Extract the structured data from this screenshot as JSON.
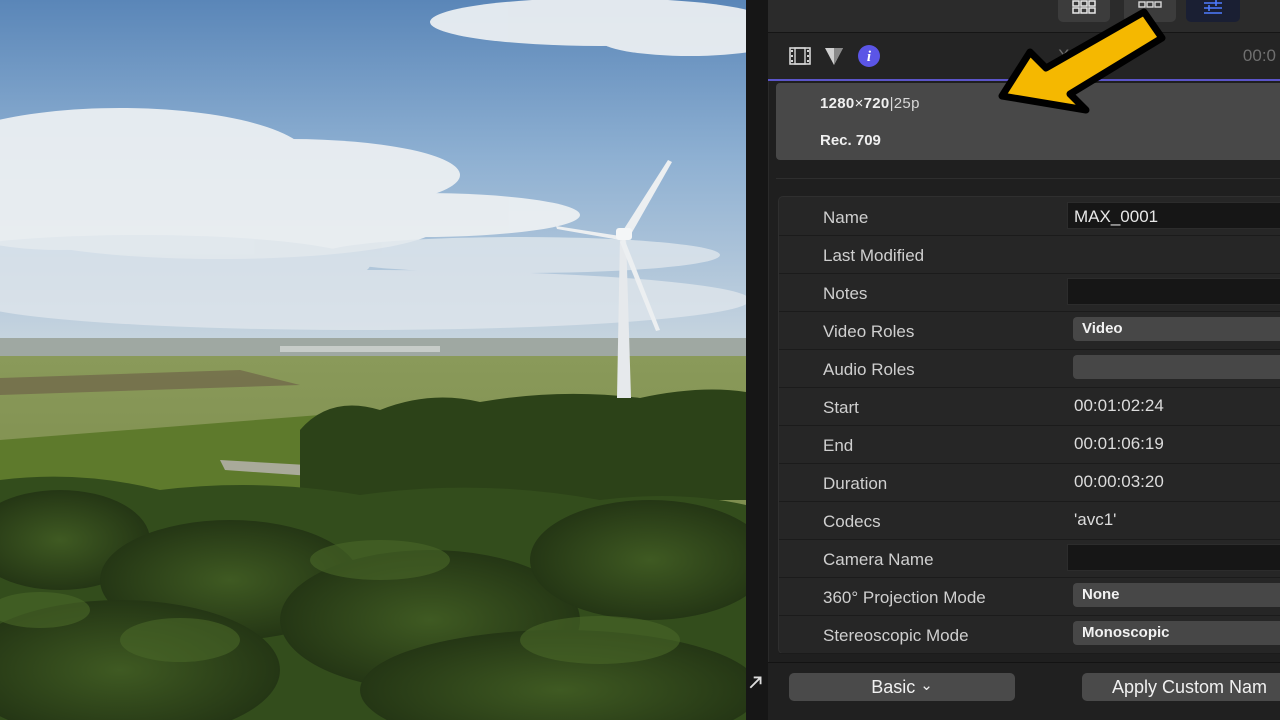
{
  "viewer": {},
  "inspector": {
    "toolbar": {
      "icons": [
        "grid-view-icon",
        "filmstrip-view-icon",
        "inspector-sliders-icon"
      ]
    },
    "tabs": {
      "icons": [
        "film-icon",
        "audio-triangle-icon",
        "info-icon"
      ],
      "clip_name": "X",
      "timecode": "00:0"
    },
    "summary": {
      "width": "1280",
      "times": "×",
      "height": "720",
      "separator": "|",
      "frame_rate": "25p",
      "color_space": "Rec. 709"
    },
    "properties": [
      {
        "label": "Name",
        "kind": "field",
        "value": "MAX_0001"
      },
      {
        "label": "Last Modified",
        "kind": "text",
        "value": ""
      },
      {
        "label": "Notes",
        "kind": "field",
        "value": ""
      },
      {
        "label": "Video Roles",
        "kind": "popup",
        "value": "Video"
      },
      {
        "label": "Audio Roles",
        "kind": "popup",
        "value": ""
      },
      {
        "label": "Start",
        "kind": "text",
        "value": "00:01:02:24"
      },
      {
        "label": "End",
        "kind": "text",
        "value": "00:01:06:19"
      },
      {
        "label": "Duration",
        "kind": "text",
        "value": "00:00:03:20"
      },
      {
        "label": "Codecs",
        "kind": "text",
        "value": "'avc1'"
      },
      {
        "label": "Camera Name",
        "kind": "field",
        "value": ""
      },
      {
        "label": "360° Projection Mode",
        "kind": "popup",
        "value": "None"
      },
      {
        "label": "Stereoscopic Mode",
        "kind": "popup",
        "value": "Monoscopic"
      }
    ],
    "bottom": {
      "metadata_view_label": "Basic",
      "chevron": "⌄",
      "apply_label": "Apply Custom Nam"
    }
  },
  "annotation": {
    "arrow_color": "#f5b800"
  }
}
